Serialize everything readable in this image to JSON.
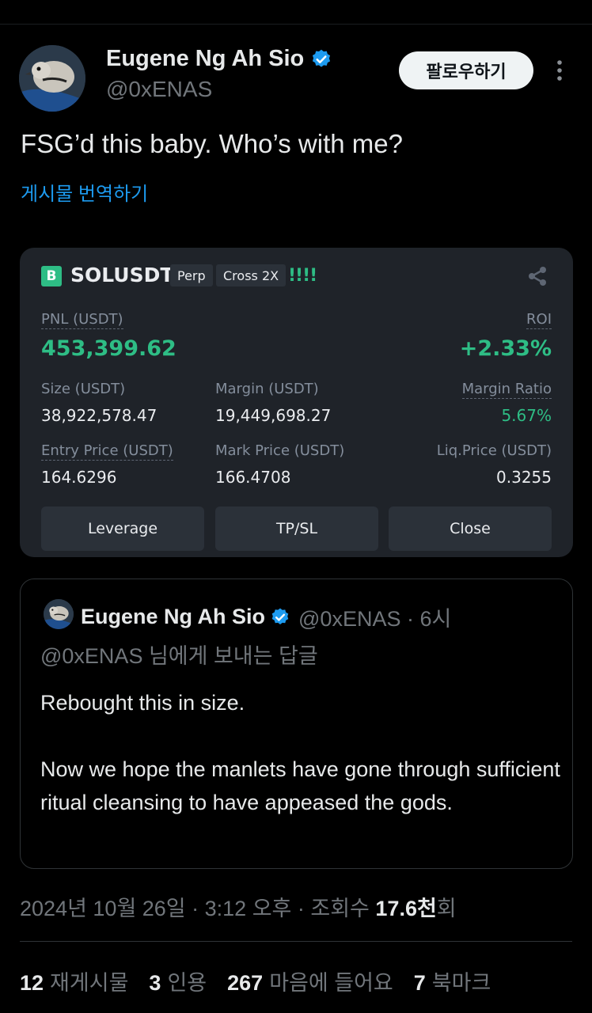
{
  "author": {
    "name": "Eugene Ng Ah Sio",
    "handle": "@0xENAS",
    "follow_label": "팔로우하기"
  },
  "tweet": {
    "text": "FSG’d this baby. Who’s with me?",
    "translate_label": "게시물 번역하기"
  },
  "position_card": {
    "logo_letter": "B",
    "symbol": "SOLUSDT",
    "tag_perp": "Perp",
    "tag_cross": "Cross 2X",
    "leverage_bars": "!!!!",
    "pnl_label": "PNL (USDT)",
    "pnl_value": "453,399.62",
    "roi_label": "ROI",
    "roi_value": "+2.33%",
    "size_label": "Size (USDT)",
    "size_value": "38,922,578.47",
    "margin_label": "Margin (USDT)",
    "margin_value": "19,449,698.27",
    "margin_ratio_label": "Margin Ratio",
    "margin_ratio_value": "5.67%",
    "entry_label": "Entry Price (USDT)",
    "entry_value": "164.6296",
    "mark_label": "Mark Price (USDT)",
    "mark_value": "166.4708",
    "liq_label": "Liq.Price (USDT)",
    "liq_value": "0.3255",
    "buttons": [
      "Leverage",
      "TP/SL",
      "Close"
    ],
    "accent_color": "#2ebd85"
  },
  "quote": {
    "name": "Eugene Ng Ah Sio",
    "meta": "@0xENAS · 6시",
    "reply_to": "@0xENAS 님에게 보내는 답글",
    "line1": "Rebought this in size.",
    "line2": "Now we hope the manlets have gone through sufficient ritual cleansing to have appeased the gods."
  },
  "timestamp": {
    "date": "2024년 10월 26일 · 3:12 오후 · 조회수 ",
    "views": "17.6천",
    "views_suffix": "회"
  },
  "stats": [
    {
      "count": "12",
      "label": "재게시물"
    },
    {
      "count": "3",
      "label": "인용"
    },
    {
      "count": "267",
      "label": "마음에 들어요"
    },
    {
      "count": "7",
      "label": "북마크"
    }
  ],
  "colors": {
    "link": "#1d9bf0",
    "verified": "#1d9bf0"
  }
}
